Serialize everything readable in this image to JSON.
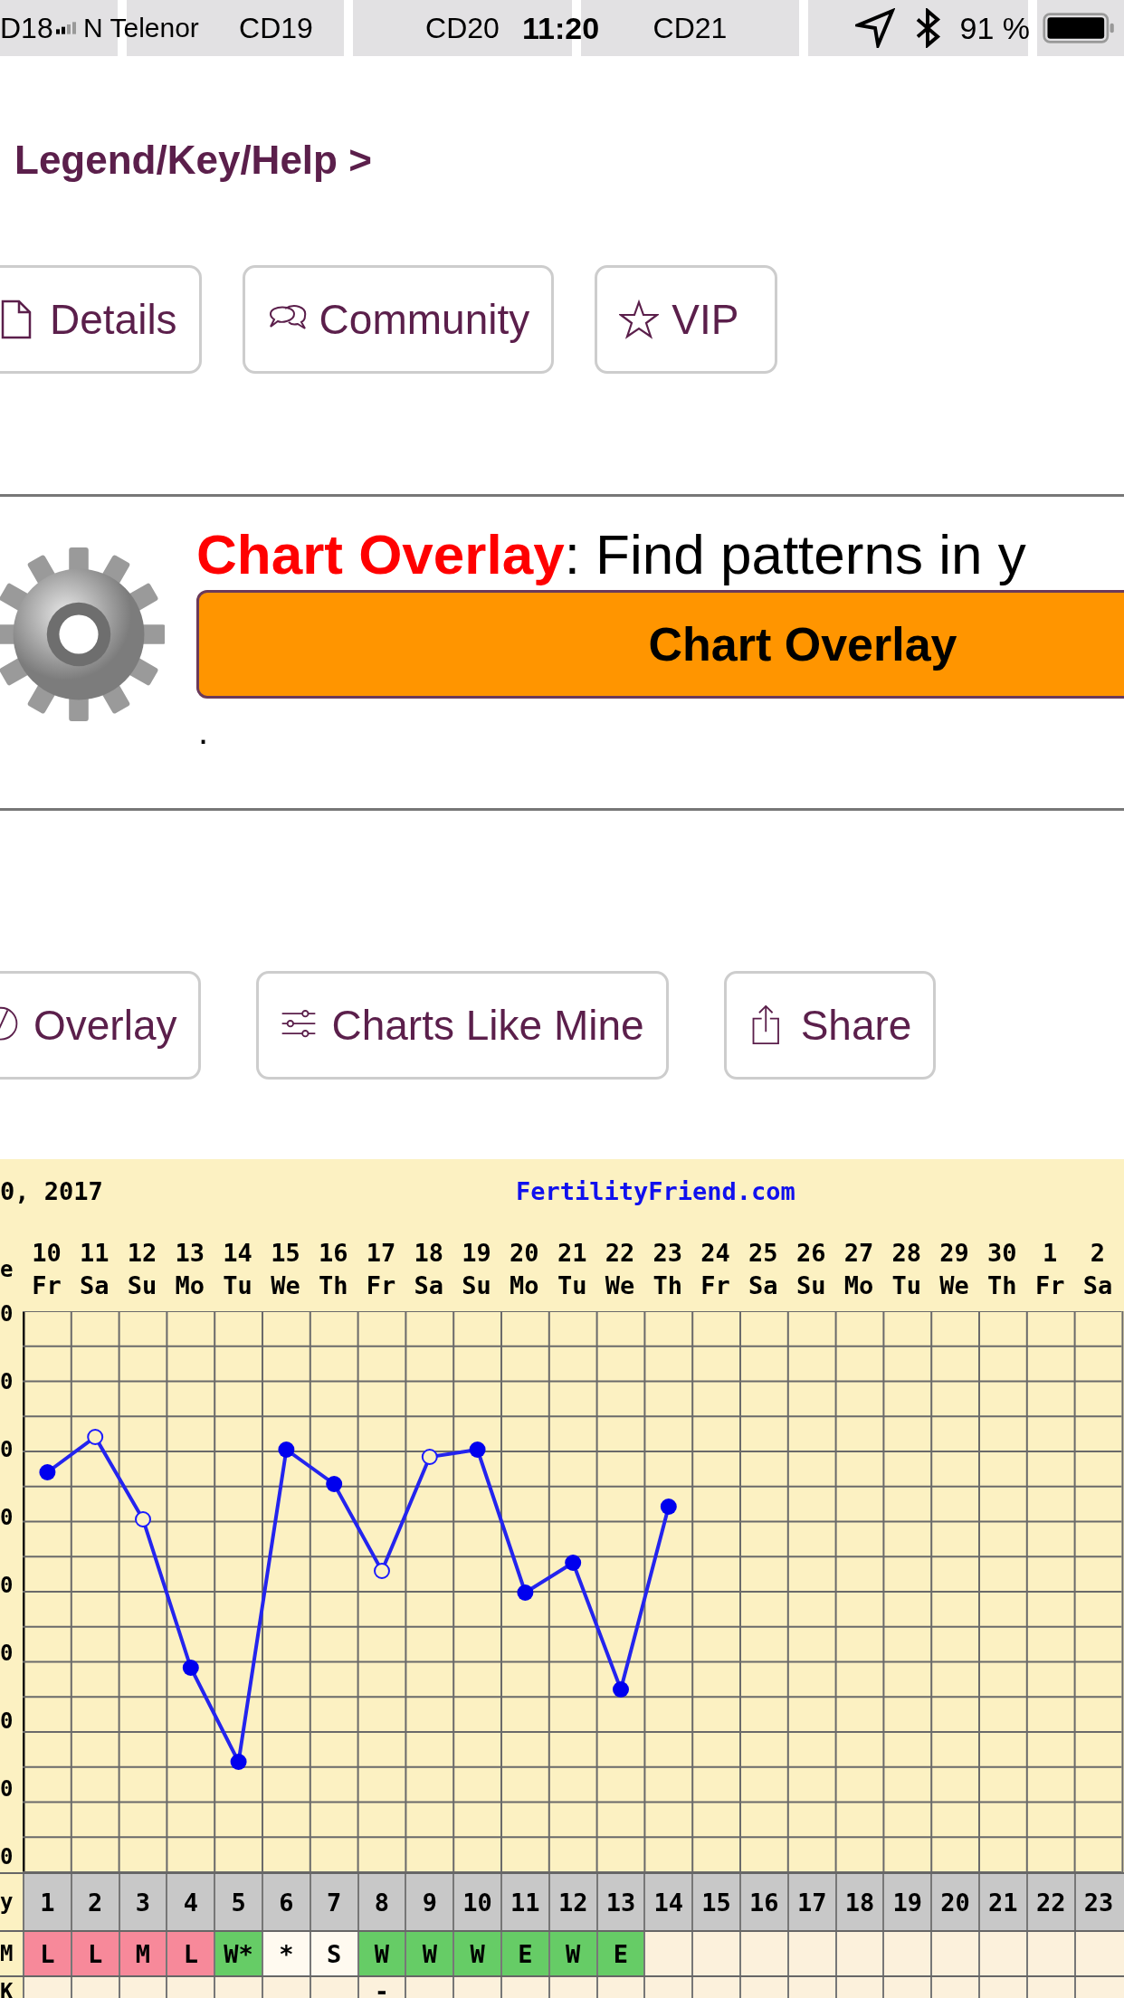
{
  "status_bar": {
    "segments": [
      "D18",
      "CD19",
      "CD20",
      "CD21"
    ],
    "carrier": "N Telenor",
    "time": "11:20",
    "battery": "91 %"
  },
  "help_link": "Legend/Key/Help >",
  "top_buttons": [
    "Details",
    "Community",
    "VIP"
  ],
  "overlay_promo": {
    "title": "Chart Overlay",
    "description": ": Find patterns in y",
    "button": "Chart Overlay",
    "note": "."
  },
  "tool_buttons": [
    "Overlay",
    "Charts Like Mine",
    "Share"
  ],
  "chart": {
    "date_header": "0, 2017",
    "site": "FertilityFriend.com",
    "date_row_label": "e",
    "y_tick_labels": [
      "0",
      "0",
      "0",
      "0",
      "0",
      "0",
      "0",
      "0",
      "0"
    ],
    "cycle_day_label": "y",
    "code_label": "M",
    "extra_row_label": "K",
    "columns": [
      {
        "date": "10",
        "weekday": "Fr",
        "cycle_day": "1",
        "code": "L",
        "color": "#f7899a"
      },
      {
        "date": "11",
        "weekday": "Sa",
        "cycle_day": "2",
        "code": "L",
        "color": "#f7899a"
      },
      {
        "date": "12",
        "weekday": "Su",
        "cycle_day": "3",
        "code": "M",
        "color": "#f7899a"
      },
      {
        "date": "13",
        "weekday": "Mo",
        "cycle_day": "4",
        "code": "L",
        "color": "#f7899a"
      },
      {
        "date": "14",
        "weekday": "Tu",
        "cycle_day": "5",
        "code": "W*",
        "color": "#66cc66"
      },
      {
        "date": "15",
        "weekday": "We",
        "cycle_day": "6",
        "code": "*",
        "color": "#fffaf0"
      },
      {
        "date": "16",
        "weekday": "Th",
        "cycle_day": "7",
        "code": "S",
        "color": "#fffaf0"
      },
      {
        "date": "17",
        "weekday": "Fr",
        "cycle_day": "8",
        "code": "W",
        "color": "#66cc66",
        "mark": "-"
      },
      {
        "date": "18",
        "weekday": "Sa",
        "cycle_day": "9",
        "code": "W",
        "color": "#66cc66"
      },
      {
        "date": "19",
        "weekday": "Su",
        "cycle_day": "10",
        "code": "W",
        "color": "#66cc66"
      },
      {
        "date": "20",
        "weekday": "Mo",
        "cycle_day": "11",
        "code": "E",
        "color": "#66cc66"
      },
      {
        "date": "21",
        "weekday": "Tu",
        "cycle_day": "12",
        "code": "W",
        "color": "#66cc66"
      },
      {
        "date": "22",
        "weekday": "We",
        "cycle_day": "13",
        "code": "E",
        "color": "#66cc66"
      },
      {
        "date": "23",
        "weekday": "Th",
        "cycle_day": "14"
      },
      {
        "date": "24",
        "weekday": "Fr",
        "cycle_day": "15"
      },
      {
        "date": "25",
        "weekday": "Sa",
        "cycle_day": "16"
      },
      {
        "date": "26",
        "weekday": "Su",
        "cycle_day": "17"
      },
      {
        "date": "27",
        "weekday": "Mo",
        "cycle_day": "18"
      },
      {
        "date": "28",
        "weekday": "Tu",
        "cycle_day": "19"
      },
      {
        "date": "29",
        "weekday": "We",
        "cycle_day": "20"
      },
      {
        "date": "30",
        "weekday": "Th",
        "cycle_day": "21"
      },
      {
        "date": "1",
        "weekday": "Fr",
        "cycle_day": "22"
      },
      {
        "date": "2",
        "weekday": "Sa",
        "cycle_day": "23"
      }
    ]
  }
}
